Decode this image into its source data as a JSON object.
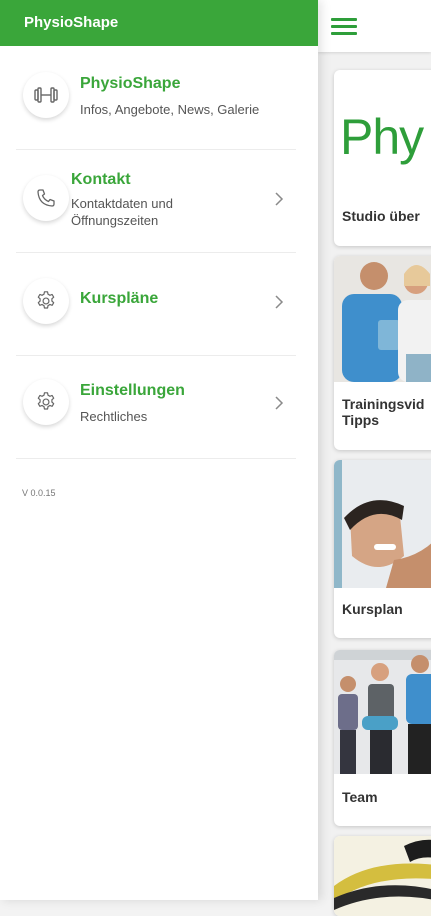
{
  "drawer": {
    "title": "PhysioShape",
    "items": [
      {
        "title": "PhysioShape",
        "subtitle": "Infos, Angebote, News, Galerie",
        "icon": "dumbbell-icon"
      },
      {
        "title": "Kontakt",
        "subtitle": "Kontaktdaten und\nÖffnungszeiten",
        "icon": "phone-icon"
      },
      {
        "title": "Kurspläne",
        "subtitle": "",
        "icon": "gear-icon"
      },
      {
        "title": "Einstellungen",
        "subtitle": "Rechtliches",
        "icon": "gear-icon"
      }
    ],
    "version": "V 0.0.15"
  },
  "main": {
    "logo_text": "Phy",
    "cards": [
      {
        "label": "Studio über"
      },
      {
        "label": "Trainingsvid\nTipps"
      },
      {
        "label": "Kursplan"
      },
      {
        "label": "Team"
      }
    ]
  },
  "colors": {
    "accent": "#3aa63a",
    "header": "#3aa63a"
  }
}
